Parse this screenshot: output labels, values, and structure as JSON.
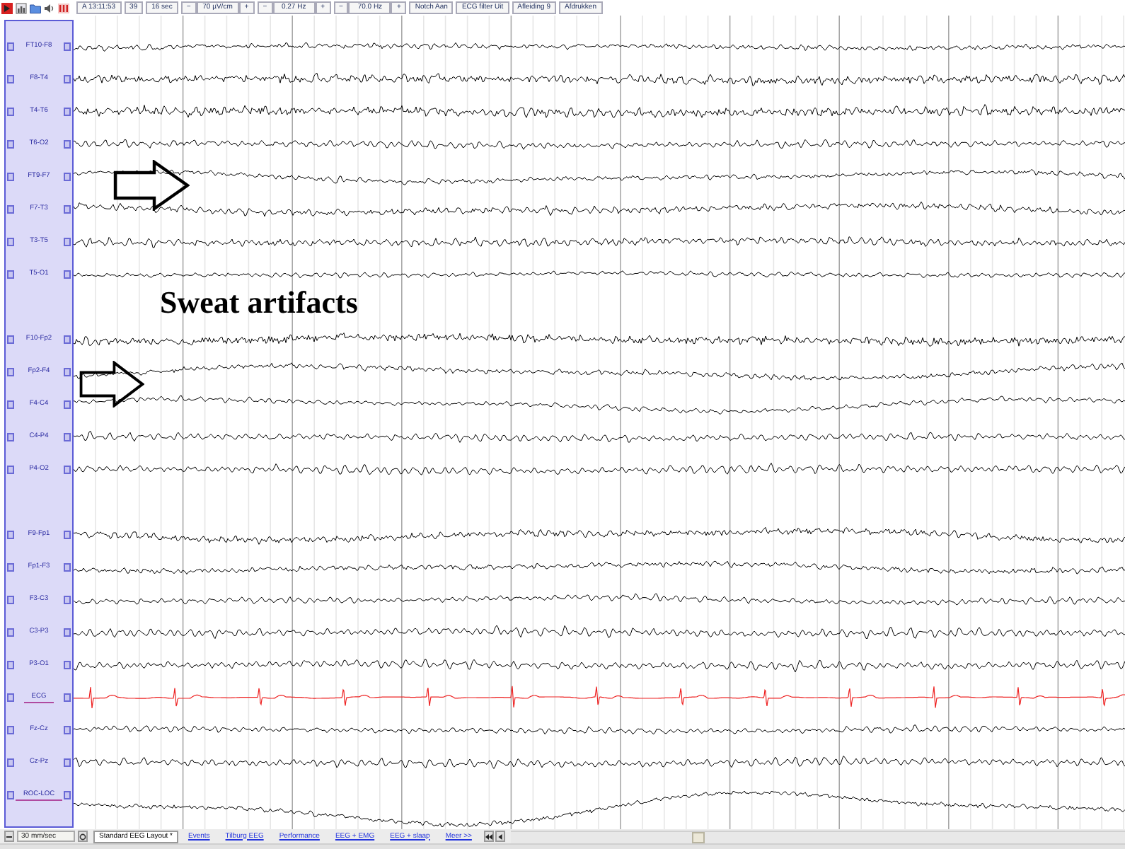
{
  "toolbar": {
    "readouts": [
      "A 13:11:53",
      "39",
      "16 sec"
    ],
    "steppers": [
      {
        "minus": "−",
        "value": "70 µV/cm",
        "plus": "+"
      },
      {
        "minus": "−",
        "value": "0.27 Hz",
        "plus": "+"
      },
      {
        "minus": "−",
        "value": "70.0 Hz",
        "plus": "+"
      }
    ],
    "buttons": [
      "Notch Aan",
      "ECG filter Uit",
      "Afleiding 9",
      "Afdrukken"
    ]
  },
  "montage": {
    "groups": [
      {
        "channels": [
          {
            "label": "FT10-F8",
            "kind": "eeg",
            "color": "#000000",
            "underlined": false
          },
          {
            "label": "F8-T4",
            "kind": "eeg",
            "color": "#000000",
            "underlined": false
          },
          {
            "label": "T4-T6",
            "kind": "eeg",
            "color": "#000000",
            "underlined": false
          },
          {
            "label": "T6-O2",
            "kind": "eeg",
            "color": "#000000",
            "underlined": false
          },
          {
            "label": "FT9-F7",
            "kind": "eeg",
            "color": "#000000",
            "underlined": false
          },
          {
            "label": "F7-T3",
            "kind": "eeg",
            "color": "#000000",
            "underlined": false
          },
          {
            "label": "T3-T5",
            "kind": "eeg",
            "color": "#000000",
            "underlined": false
          },
          {
            "label": "T5-O1",
            "kind": "eeg",
            "color": "#000000",
            "underlined": false
          }
        ]
      },
      {
        "channels": [
          {
            "label": "F10-Fp2",
            "kind": "eeg",
            "color": "#000000",
            "underlined": false
          },
          {
            "label": "Fp2-F4",
            "kind": "eeg",
            "color": "#000000",
            "underlined": false
          },
          {
            "label": "F4-C4",
            "kind": "eeg",
            "color": "#000000",
            "underlined": false
          },
          {
            "label": "C4-P4",
            "kind": "eeg",
            "color": "#000000",
            "underlined": false
          },
          {
            "label": "P4-O2",
            "kind": "eeg",
            "color": "#000000",
            "underlined": false
          }
        ]
      },
      {
        "channels": [
          {
            "label": "F9-Fp1",
            "kind": "eeg",
            "color": "#000000",
            "underlined": false
          },
          {
            "label": "Fp1-F3",
            "kind": "eeg",
            "color": "#000000",
            "underlined": false
          },
          {
            "label": "F3-C3",
            "kind": "eeg",
            "color": "#000000",
            "underlined": false
          },
          {
            "label": "C3-P3",
            "kind": "eeg",
            "color": "#000000",
            "underlined": false
          },
          {
            "label": "P3-O1",
            "kind": "eeg",
            "color": "#000000",
            "underlined": false
          },
          {
            "label": "ECG",
            "kind": "ecg",
            "color": "#ee2222",
            "underlined": true
          },
          {
            "label": "Fz-Cz",
            "kind": "eeg",
            "color": "#000000",
            "underlined": false
          },
          {
            "label": "Cz-Pz",
            "kind": "eeg",
            "color": "#000000",
            "underlined": false
          },
          {
            "label": "ROC-LOC",
            "kind": "eeg",
            "color": "#000000",
            "underlined": true
          }
        ]
      }
    ]
  },
  "annotation": {
    "title": "Sweat artifacts"
  },
  "bottom_bar": {
    "paper_speed": "30 mm/sec",
    "layout_tabs": [
      {
        "label": "Standard EEG Layout *",
        "selected": true
      },
      {
        "label": "Events",
        "selected": false
      },
      {
        "label": "Tilburg EEG",
        "selected": false
      },
      {
        "label": "Performance",
        "selected": false
      },
      {
        "label": "EEG + EMG",
        "selected": false
      },
      {
        "label": "EEG + slaap",
        "selected": false
      },
      {
        "label": "Meer >>",
        "selected": false
      }
    ]
  }
}
